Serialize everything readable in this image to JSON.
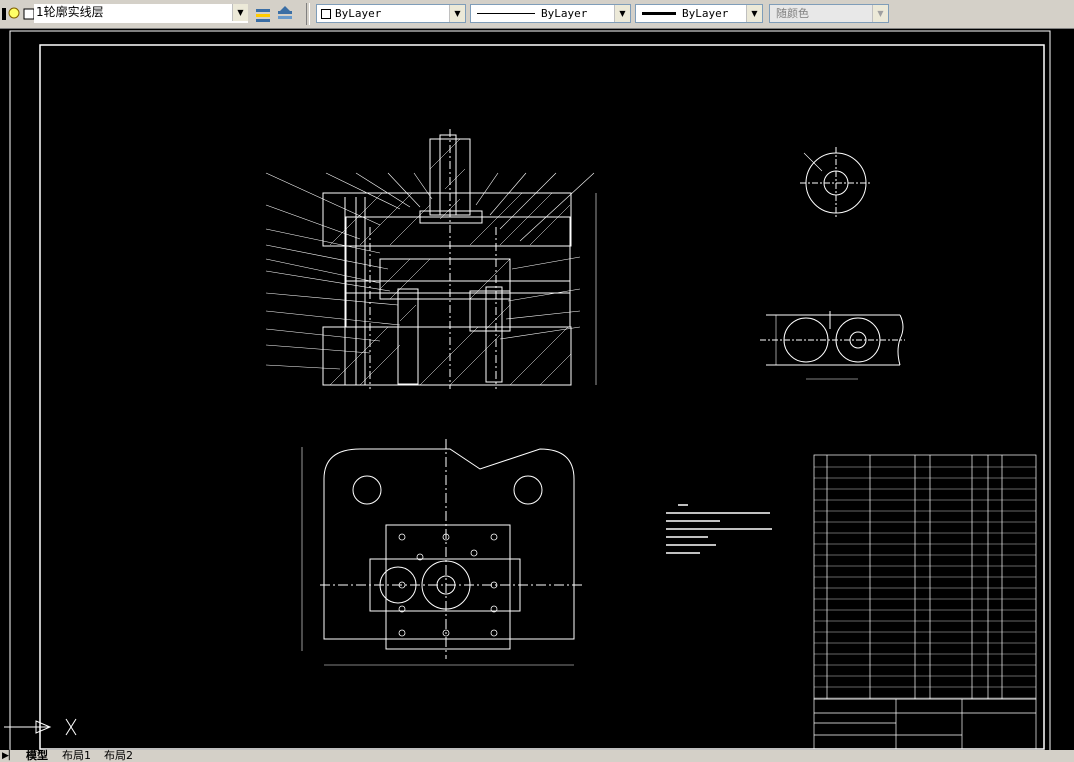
{
  "toolbar": {
    "layer_name": "1轮廓实线层",
    "color_value": "ByLayer",
    "linetype_value": "ByLayer",
    "lineweight_value": "ByLayer",
    "plotstyle_value": "随颜色"
  },
  "tabs": [
    "模型",
    "布局1",
    "布局2"
  ],
  "colors": {
    "canvas": "#000000",
    "lines": "#ffffff",
    "toolbar": "#d4d0c8"
  }
}
